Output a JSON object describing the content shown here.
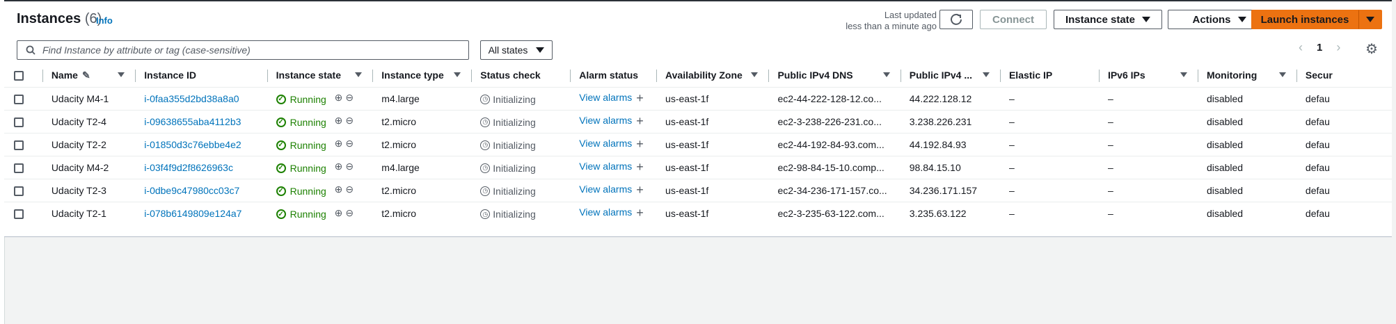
{
  "header": {
    "title": "Instances",
    "count": "(6)",
    "info": "Info",
    "last_updated_line1": "Last updated",
    "last_updated_line2": "less than a minute ago",
    "connect": "Connect",
    "instance_state": "Instance state",
    "actions": "Actions",
    "launch": "Launch instances"
  },
  "filter": {
    "search_placeholder": "Find Instance by attribute or tag (case-sensitive)",
    "states": "All states",
    "page": "1"
  },
  "columns": [
    "Name",
    "Instance ID",
    "Instance state",
    "Instance type",
    "Status check",
    "Alarm status",
    "Availability Zone",
    "Public IPv4 DNS",
    "Public IPv4 ...",
    "Elastic IP",
    "IPv6 IPs",
    "Monitoring",
    "Secur"
  ],
  "rows": [
    {
      "name": "Udacity M4-1",
      "id": "i-0faa355d2bd38a8a0",
      "state": "Running",
      "type": "m4.large",
      "status": "Initializing",
      "alarm": "View alarms",
      "az": "us-east-1f",
      "dns": "ec2-44-222-128-12.co...",
      "ip": "44.222.128.12",
      "eip": "–",
      "ipv6": "–",
      "monitoring": "disabled",
      "sg": "defau"
    },
    {
      "name": "Udacity T2-4",
      "id": "i-09638655aba4112b3",
      "state": "Running",
      "type": "t2.micro",
      "status": "Initializing",
      "alarm": "View alarms",
      "az": "us-east-1f",
      "dns": "ec2-3-238-226-231.co...",
      "ip": "3.238.226.231",
      "eip": "–",
      "ipv6": "–",
      "monitoring": "disabled",
      "sg": "defau"
    },
    {
      "name": "Udacity T2-2",
      "id": "i-01850d3c76ebbe4e2",
      "state": "Running",
      "type": "t2.micro",
      "status": "Initializing",
      "alarm": "View alarms",
      "az": "us-east-1f",
      "dns": "ec2-44-192-84-93.com...",
      "ip": "44.192.84.93",
      "eip": "–",
      "ipv6": "–",
      "monitoring": "disabled",
      "sg": "defau"
    },
    {
      "name": "Udacity M4-2",
      "id": "i-03f4f9d2f8626963c",
      "state": "Running",
      "type": "m4.large",
      "status": "Initializing",
      "alarm": "View alarms",
      "az": "us-east-1f",
      "dns": "ec2-98-84-15-10.comp...",
      "ip": "98.84.15.10",
      "eip": "–",
      "ipv6": "–",
      "monitoring": "disabled",
      "sg": "defau"
    },
    {
      "name": "Udacity T2-3",
      "id": "i-0dbe9c47980cc03c7",
      "state": "Running",
      "type": "t2.micro",
      "status": "Initializing",
      "alarm": "View alarms",
      "az": "us-east-1f",
      "dns": "ec2-34-236-171-157.co...",
      "ip": "34.236.171.157",
      "eip": "–",
      "ipv6": "–",
      "monitoring": "disabled",
      "sg": "defau"
    },
    {
      "name": "Udacity T2-1",
      "id": "i-078b6149809e124a7",
      "state": "Running",
      "type": "t2.micro",
      "status": "Initializing",
      "alarm": "View alarms",
      "az": "us-east-1f",
      "dns": "ec2-3-235-63-122.com...",
      "ip": "3.235.63.122",
      "eip": "–",
      "ipv6": "–",
      "monitoring": "disabled",
      "sg": "defau"
    }
  ],
  "colors": {
    "accent": "#ec7211",
    "link": "#0073bb",
    "success": "#1d8102"
  },
  "icons": [
    "refresh-icon",
    "search-icon",
    "settings-gear-icon",
    "edit-icon",
    "check-circle-icon",
    "zoom-in-icon",
    "zoom-out-icon",
    "clock-icon",
    "plus-icon"
  ]
}
